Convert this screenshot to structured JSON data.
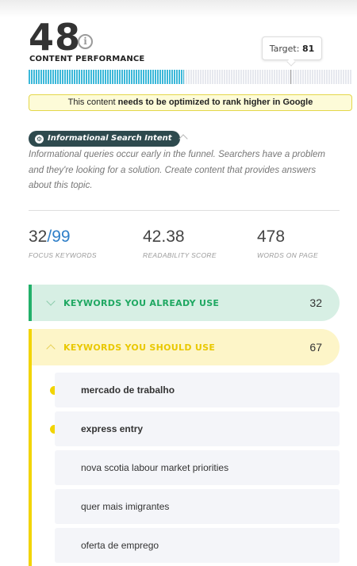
{
  "score": {
    "value": "48",
    "label": "CONTENT PERFORMANCE",
    "info_icon": "info-icon",
    "progress_percent": 48,
    "target_label": "Target:",
    "target_value": "81",
    "target_percent": 81
  },
  "notice": {
    "prefix": "This content ",
    "emphasis": "needs to be optimized to rank higher in Google"
  },
  "intent": {
    "badge_icon": "intent-icon",
    "badge_label": "Informational Search Intent",
    "description": "Informational queries occur early in the funnel. Searchers have a problem and they're looking for a solution. Create content that provides answers about this topic."
  },
  "stats": [
    {
      "value": "32",
      "total": "/99",
      "label": "FOCUS KEYWORDS"
    },
    {
      "value": "42.38",
      "total": "",
      "label": "READABILITY SCORE"
    },
    {
      "value": "478",
      "total": "",
      "label": "WORDS ON PAGE"
    }
  ],
  "sections": {
    "already_use": {
      "title": "KEYWORDS YOU ALREADY USE",
      "count": "32"
    },
    "should_use": {
      "title": "KEYWORDS YOU SHOULD USE",
      "count": "67"
    }
  },
  "keywords": [
    {
      "text": "mercado de trabalho",
      "highlighted": true
    },
    {
      "text": "express entry",
      "highlighted": true
    },
    {
      "text": "nova scotia labour market priorities",
      "highlighted": false
    },
    {
      "text": "quer mais imigrantes",
      "highlighted": false
    },
    {
      "text": "oferta de emprego",
      "highlighted": false
    }
  ],
  "colors": {
    "accent_blue": "#3bb8d9",
    "used_green": "#22b06a",
    "should_yellow": "#f2d400",
    "badge_dark": "#2e4a4e"
  }
}
